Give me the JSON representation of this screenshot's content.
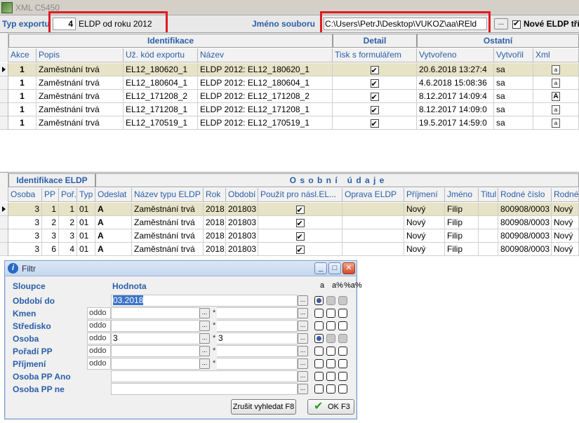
{
  "window": {
    "title": "XML C5450"
  },
  "export": {
    "type_label": "Typ exportu",
    "type_number": "4",
    "type_desc": "ELDP od roku 2012",
    "filename_label": "Jméno souboru",
    "filename_value": "C:\\Users\\PetrJ\\Desktop\\VUKOZ\\aa\\REld",
    "browse_label": "...",
    "new_eldp_label": "Nové ELDP tří",
    "new_eldp_checked": true
  },
  "top_grid": {
    "groups": [
      "Identifikace",
      "Detail",
      "Ostatní"
    ],
    "columns": [
      "Akce",
      "Popis",
      "Už. kód exportu",
      "Název",
      "Tisk s formulářem",
      "Vytvořeno",
      "Vytvořil",
      "Xml"
    ],
    "rows": [
      {
        "akce": "1",
        "popis": "Zaměstnání trvá",
        "kod": "EL12_180620_1",
        "nazev": "ELDP 2012: EL12_180620_1",
        "tisk": true,
        "vytvoreno": "20.6.2018 13:27:4",
        "vytvoril": "sa",
        "xml": "a"
      },
      {
        "akce": "1",
        "popis": "Zaměstnání trvá",
        "kod": "EL12_180604_1",
        "nazev": "ELDP 2012: EL12_180604_1",
        "tisk": true,
        "vytvoreno": "4.6.2018 15:08:36",
        "vytvoril": "sa",
        "xml": "a"
      },
      {
        "akce": "1",
        "popis": "Zaměstnání trvá",
        "kod": "EL12_171208_2",
        "nazev": "ELDP 2012: EL12_171208_2",
        "tisk": true,
        "vytvoreno": "8.12.2017 14:09:4",
        "vytvoril": "sa",
        "xml": "A"
      },
      {
        "akce": "1",
        "popis": "Zaměstnání trvá",
        "kod": "EL12_171208_1",
        "nazev": "ELDP 2012: EL12_171208_1",
        "tisk": true,
        "vytvoreno": "8.12.2017 14:09:0",
        "vytvoril": "sa",
        "xml": "a"
      },
      {
        "akce": "1",
        "popis": "Zaměstnání trvá",
        "kod": "EL12_170519_1",
        "nazev": "ELDP 2012: EL12_170519_1",
        "tisk": true,
        "vytvoreno": "19.5.2017 14:59:0",
        "vytvoril": "sa",
        "xml": "a"
      }
    ]
  },
  "bottom_grid": {
    "groups": [
      "Identifikace ELDP",
      "O s o b n í   ú d a j e"
    ],
    "columns": [
      "Osoba",
      "PP",
      "Poř.",
      "Typ",
      "Odeslat",
      "Název typu ELDP",
      "Rok",
      "Období",
      "Použít pro násl.EL...",
      "Oprava ELDP",
      "Příjmení",
      "Jméno",
      "Titul",
      "Rodné číslo",
      "Rodné"
    ],
    "rows": [
      {
        "osoba": "3",
        "pp": "1",
        "por": "1",
        "typ": "01",
        "odeslat": "A",
        "nazev_typu": "Zaměstnání trvá",
        "rok": "2018",
        "obdobi": "201803",
        "pouzit": true,
        "oprava": "",
        "prijmeni": "Nový",
        "jmeno": "Filip",
        "titul": "",
        "rc": "800908/0003",
        "rodne": "Nový"
      },
      {
        "osoba": "3",
        "pp": "2",
        "por": "2",
        "typ": "01",
        "odeslat": "A",
        "nazev_typu": "Zaměstnání trvá",
        "rok": "2018",
        "obdobi": "201803",
        "pouzit": true,
        "oprava": "",
        "prijmeni": "Nový",
        "jmeno": "Filip",
        "titul": "",
        "rc": "800908/0003",
        "rodne": "Nový"
      },
      {
        "osoba": "3",
        "pp": "3",
        "por": "3",
        "typ": "01",
        "odeslat": "A",
        "nazev_typu": "Zaměstnání trvá",
        "rok": "2018",
        "obdobi": "201803",
        "pouzit": true,
        "oprava": "",
        "prijmeni": "Nový",
        "jmeno": "Filip",
        "titul": "",
        "rc": "800908/0003",
        "rodne": "Nový"
      },
      {
        "osoba": "3",
        "pp": "6",
        "por": "4",
        "typ": "01",
        "odeslat": "A",
        "nazev_typu": "Zaměstnání trvá",
        "rok": "2018",
        "obdobi": "201803",
        "pouzit": true,
        "oprava": "",
        "prijmeni": "Nový",
        "jmeno": "Filip",
        "titul": "",
        "rc": "800908/0003",
        "rodne": "Nový"
      }
    ]
  },
  "filter": {
    "title": "Filtr",
    "col_header": "Sloupce",
    "value_header": "Hodnota",
    "flag_headers": [
      "a",
      "a%",
      "%a%"
    ],
    "rows": [
      {
        "label": "Období do",
        "oddo": "",
        "value": "03.2018",
        "value_selected": true,
        "star": "",
        "value2": "",
        "radios": [
          true,
          false,
          false
        ]
      },
      {
        "label": "Kmen",
        "oddo": "oddo",
        "value": "",
        "star": "*",
        "value2": "",
        "radios": [
          false,
          false,
          false
        ]
      },
      {
        "label": "Středisko",
        "oddo": "oddo",
        "value": "",
        "star": "*",
        "value2": "",
        "radios": [
          false,
          false,
          false
        ]
      },
      {
        "label": "Osoba",
        "oddo": "oddo",
        "value": "3",
        "star": "*",
        "value2": "3",
        "radios": [
          true,
          false,
          false
        ]
      },
      {
        "label": "Pořadí PP",
        "oddo": "oddo",
        "value": "",
        "star": "*",
        "value2": "",
        "radios": [
          false,
          false,
          false
        ]
      },
      {
        "label": "Příjmení",
        "oddo": "oddo",
        "value": "",
        "star": "*",
        "value2": "",
        "radios": [
          false,
          false,
          false
        ]
      },
      {
        "label": "Osoba PP Ano",
        "oddo": "",
        "value": "",
        "star": "",
        "value2": "",
        "radios": [
          false,
          false,
          false
        ]
      },
      {
        "label": "Osoba PP ne",
        "oddo": "",
        "value": "",
        "star": "",
        "value2": "",
        "radios": [
          false,
          false,
          false
        ]
      }
    ],
    "cancel_label": "Zrušit vyhledat F8",
    "ok_label": "OK F3",
    "dots_label": "..."
  }
}
